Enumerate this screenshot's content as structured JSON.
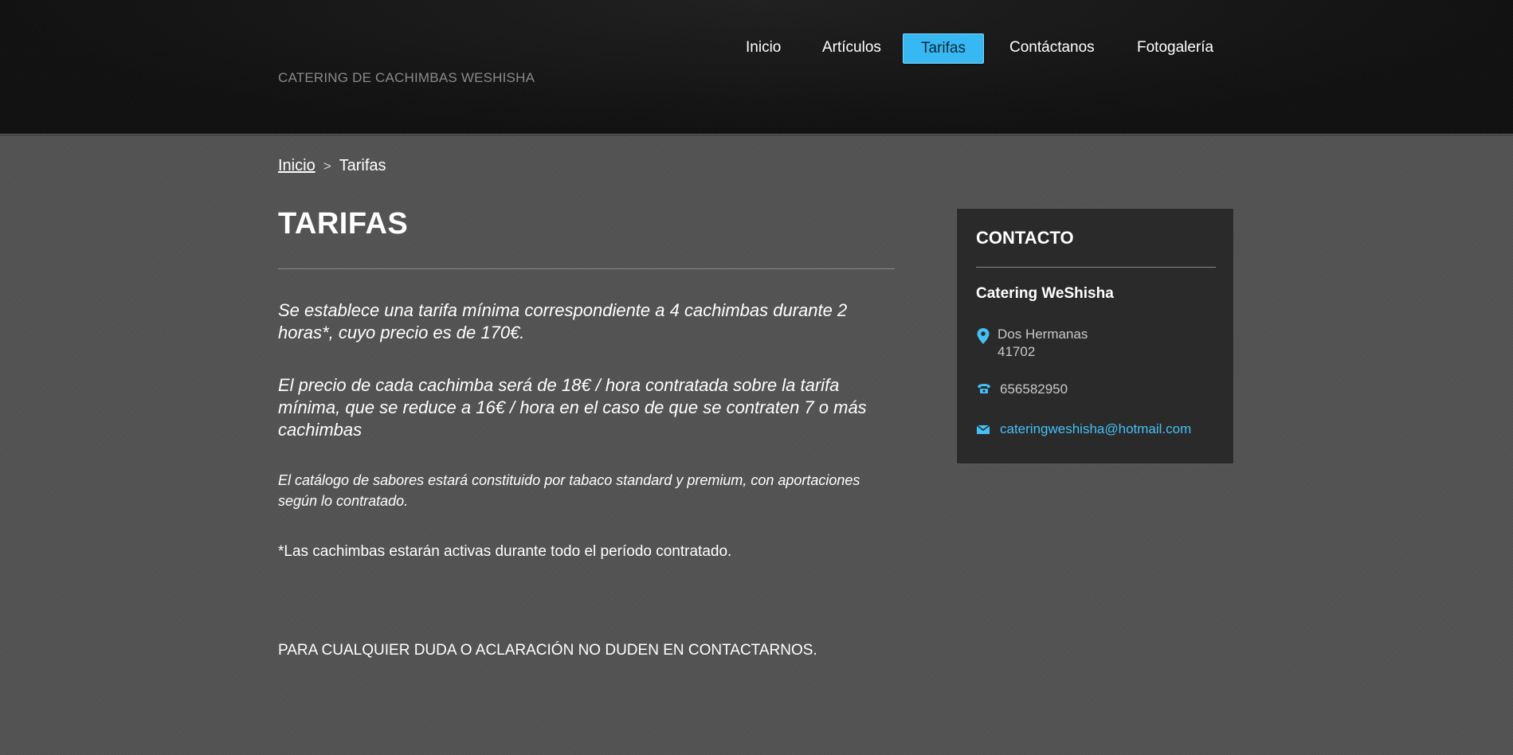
{
  "header": {
    "site_title": "CATERING DE CACHIMBAS WESHISHA",
    "nav": [
      {
        "label": "Inicio",
        "active": false
      },
      {
        "label": "Artículos",
        "active": false
      },
      {
        "label": "Tarifas",
        "active": true
      },
      {
        "label": "Contáctanos",
        "active": false
      },
      {
        "label": "Fotogalería",
        "active": false
      }
    ]
  },
  "breadcrumb": {
    "home": "Inicio",
    "separator": ">",
    "current": "Tarifas"
  },
  "main": {
    "title": "TARIFAS",
    "paragraphs": [
      "Se establece una tarifa mínima correspondiente a 4 cachimbas durante 2 horas*, cuyo precio es de 170€.",
      "El precio de cada cachimba será de 18€ / hora contratada sobre la tarifa mínima, que se reduce a 16€ / hora en el caso de que se contraten 7 o más cachimbas",
      "El catálogo de sabores estará constituido por tabaco standard y premium, con aportaciones según lo contratado.",
      "*Las cachimbas estarán activas durante todo el período contratado.",
      "PARA CUALQUIER DUDA O ACLARACIÓN NO DUDEN EN CONTACTARNOS."
    ]
  },
  "sidebar": {
    "title": "CONTACTO",
    "company": "Catering WeShisha",
    "address_line1": "Dos Hermanas",
    "address_line2": "41702",
    "phone": "656582950",
    "email": "cateringweshisha@hotmail.com",
    "icons": {
      "address": "map-pin-icon",
      "phone": "phone-icon",
      "email": "envelope-icon"
    }
  },
  "colors": {
    "accent": "#37b8f2",
    "link": "#44c0f5",
    "background": "#535353",
    "header_bg": "#111111",
    "panel_bg": "#2a2a2a"
  }
}
